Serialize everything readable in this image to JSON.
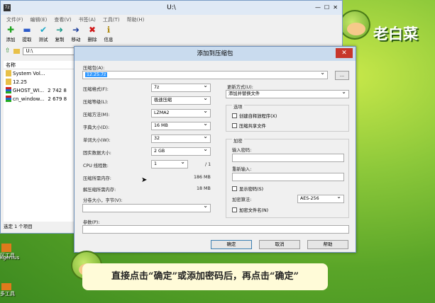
{
  "main_window": {
    "title": "U:\\",
    "app_icon": "7z",
    "menu": [
      "文件(F)",
      "编辑(E)",
      "查看(V)",
      "书签(A)",
      "工具(T)",
      "帮助(H)"
    ],
    "toolbar": [
      {
        "icon": "plus-icon",
        "label": "添加",
        "color": "#1fa31f"
      },
      {
        "icon": "minus-icon",
        "label": "提取",
        "color": "#2a59c9"
      },
      {
        "icon": "check-icon",
        "label": "测试",
        "color": "#1aa8c9"
      },
      {
        "icon": "copy-arrow-icon",
        "label": "复制",
        "color": "#1a9a8a"
      },
      {
        "icon": "move-arrow-icon",
        "label": "移动",
        "color": "#1a3c9a"
      },
      {
        "icon": "delete-x-icon",
        "label": "删除",
        "color": "#d01818"
      },
      {
        "icon": "info-icon",
        "label": "信息",
        "color": "#b08a10"
      }
    ],
    "address": "U:\\",
    "list_header": "名称",
    "files": [
      {
        "name": "System Vol...",
        "size": "",
        "icon": "folder-icon"
      },
      {
        "name": "12.25",
        "size": "",
        "icon": "folder-icon"
      },
      {
        "name": "GHOST_WI...",
        "size": "2 742 8",
        "icon": "archive-icon"
      },
      {
        "name": "cn_window...",
        "size": "2 679 8",
        "icon": "archive-icon"
      }
    ],
    "status": "选定 1 个项目"
  },
  "dialog": {
    "title": "添加到压缩包",
    "archive_label": "压缩包(A):",
    "archive_value": "12.25.7z",
    "browse": "...",
    "format_label": "压缩格式(F):",
    "format_value": "7z",
    "level_label": "压缩等级(L):",
    "level_value": "极速压缩",
    "method_label": "压缩方法(M):",
    "method_value": "LZMA2",
    "dict_label": "字典大小(D):",
    "dict_value": "16 MB",
    "word_label": "单词大小(W):",
    "word_value": "32",
    "solid_label": "固实数据大小:",
    "solid_value": "2 GB",
    "cpu_label": "CPU 线程数:",
    "cpu_value": "1",
    "cpu_total": "/ 1",
    "mem_comp_label": "压缩所需内存:",
    "mem_comp_value": "186 MB",
    "mem_decomp_label": "解压缩所需内存:",
    "mem_decomp_value": "18 MB",
    "split_label": "分卷大小，字节(V):",
    "params_label": "参数(P):",
    "update_label": "更新方式(U):",
    "update_value": "添加并替换文件",
    "options_label": "选项",
    "sfx_label": "创建自释放程序(X)",
    "shared_label": "压缩共享文件",
    "encrypt_label": "加密",
    "pwd_label": "输入密码:",
    "pwd2_label": "重新输入:",
    "show_pwd_label": "显示密码(S)",
    "enc_method_label": "加密算法:",
    "enc_method_value": "AES-256",
    "enc_names_label": "加密文件名(N)",
    "ok": "确定",
    "cancel": "取消",
    "help": "帮助"
  },
  "caption": "直接点击“确定”或添加密码后，再点击“确定”",
  "brand": "老白菜",
  "desktop_icons": [
    "区工具",
    "kgenius",
    "多工具"
  ]
}
